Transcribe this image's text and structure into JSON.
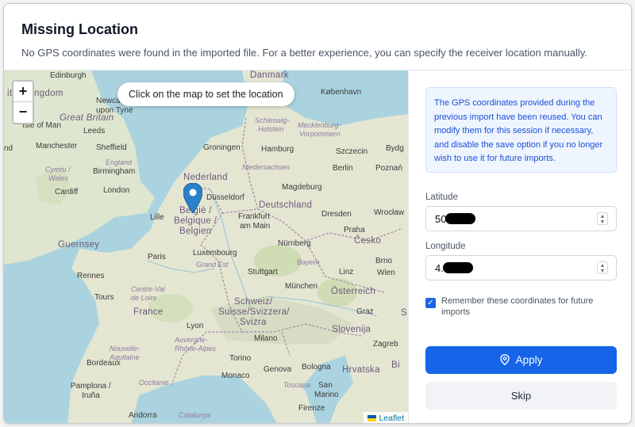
{
  "dialog": {
    "title": "Missing Location",
    "subtitle": "No GPS coordinates were found in the imported file. For a better experience, you can specify the receiver location manually."
  },
  "map": {
    "hint": "Click on the map to set the location",
    "zoom_in": "+",
    "zoom_out": "−",
    "attribution": "Leaflet",
    "labels": {
      "edinburgh": "Edinburgh",
      "united_kingdom": "ited Kingdom",
      "newcastle": "Newcastle",
      "upon_tyne": "upon Tyne",
      "great_britain": "Great Britain",
      "isle_of_man": "Isle of Man",
      "leeds": "Leeds",
      "nd": "nd",
      "manchester": "Manchester",
      "sheffield": "Sheffield",
      "cymru": "Cymru /",
      "wales": "Wales",
      "england": "England",
      "birmingham": "Birmingham",
      "cardiff": "Cardiff",
      "london": "London",
      "lille": "Lille",
      "guernsey": "Guernsey",
      "paris": "Paris",
      "rennes": "Rennes",
      "centre_val": "Centre-Val",
      "de_loire": "de Loire",
      "tours": "Tours",
      "france": "France",
      "nouvelle": "Nouvelle-",
      "aquitaine": "Aquitaine",
      "bordeaux": "Bordeaux",
      "occitanie": "Occitanie",
      "pamplona": "Pamplona /",
      "iruna": "Iruña",
      "andorra": "Andorra",
      "catalunya": "Catalunya",
      "danmark": "Danmark",
      "kobenhavn": "København",
      "schleswig": "Schleswig-",
      "holstein": "Holstein",
      "mecklenburg": "Mecklenburg-",
      "vorpommern": "Vorpommern",
      "groningen": "Groningen",
      "hamburg": "Hamburg",
      "szczecin": "Szczecin",
      "bydg": "Bydg",
      "nederland": "Nederland",
      "niedersachsen": "Niedersachsen",
      "berlin": "Berlin",
      "poznan": "Poznań",
      "dusseldorf": "Düsseldorf",
      "magdeburg": "Magdeburg",
      "belgie": "België /",
      "belgique": "Belgique /",
      "belgien": "Belgien",
      "deutschland": "Deutschland",
      "frankfurt": "Frankfurt",
      "am_main": "am Main",
      "dresden": "Dresden",
      "wroclaw": "Wrocław",
      "praha": "Praha",
      "cesko": "Česko",
      "luxembourg": "Luxembourg",
      "grand_est": "Grand Est",
      "nurnberg": "Nürnberg",
      "bayern": "Bayern",
      "stuttgart": "Stuttgart",
      "linz": "Linz",
      "brno": "Brno",
      "wien": "Wien",
      "munchen": "München",
      "osterreich": "Österreich",
      "schweiz": "Schweiz/",
      "suisse": "Suisse/Svizzera/",
      "svizra": "Svizra",
      "graz": "Graz",
      "lyon": "Lyon",
      "milano": "Milano",
      "auvergne": "Auvergne-",
      "rhone": "Rhône-Alpes",
      "slovenija": "Slovenija",
      "torino": "Torino",
      "zagreb": "Zagreb",
      "hrvatska": "Hrvatska",
      "monaco": "Monaco",
      "genova": "Genova",
      "bologna": "Bologna",
      "toscana": "Toscana",
      "san_marino_1": "San",
      "san_marino_2": "Marino",
      "firenze": "Firenze",
      "bih": "Bi",
      "srb": "S"
    }
  },
  "panel": {
    "info_text": "The GPS coordinates provided during the previous import have been reused. You can modify them for this session if necessary, and disable the save option if you no longer wish to use it for future imports.",
    "latitude_label": "Latitude",
    "latitude_value": "50",
    "longitude_label": "Longitude",
    "longitude_value": "4.",
    "remember_label": "Remember these coordinates for future imports",
    "remember_checked": true,
    "apply_label": "Apply",
    "skip_label": "Skip"
  },
  "colors": {
    "accent": "#1664e8",
    "info_bg": "#eef5ff",
    "info_text": "#1d4ed8",
    "sea": "#aad3df",
    "land": "#dfe6cf",
    "marker": "#2a81cb"
  }
}
